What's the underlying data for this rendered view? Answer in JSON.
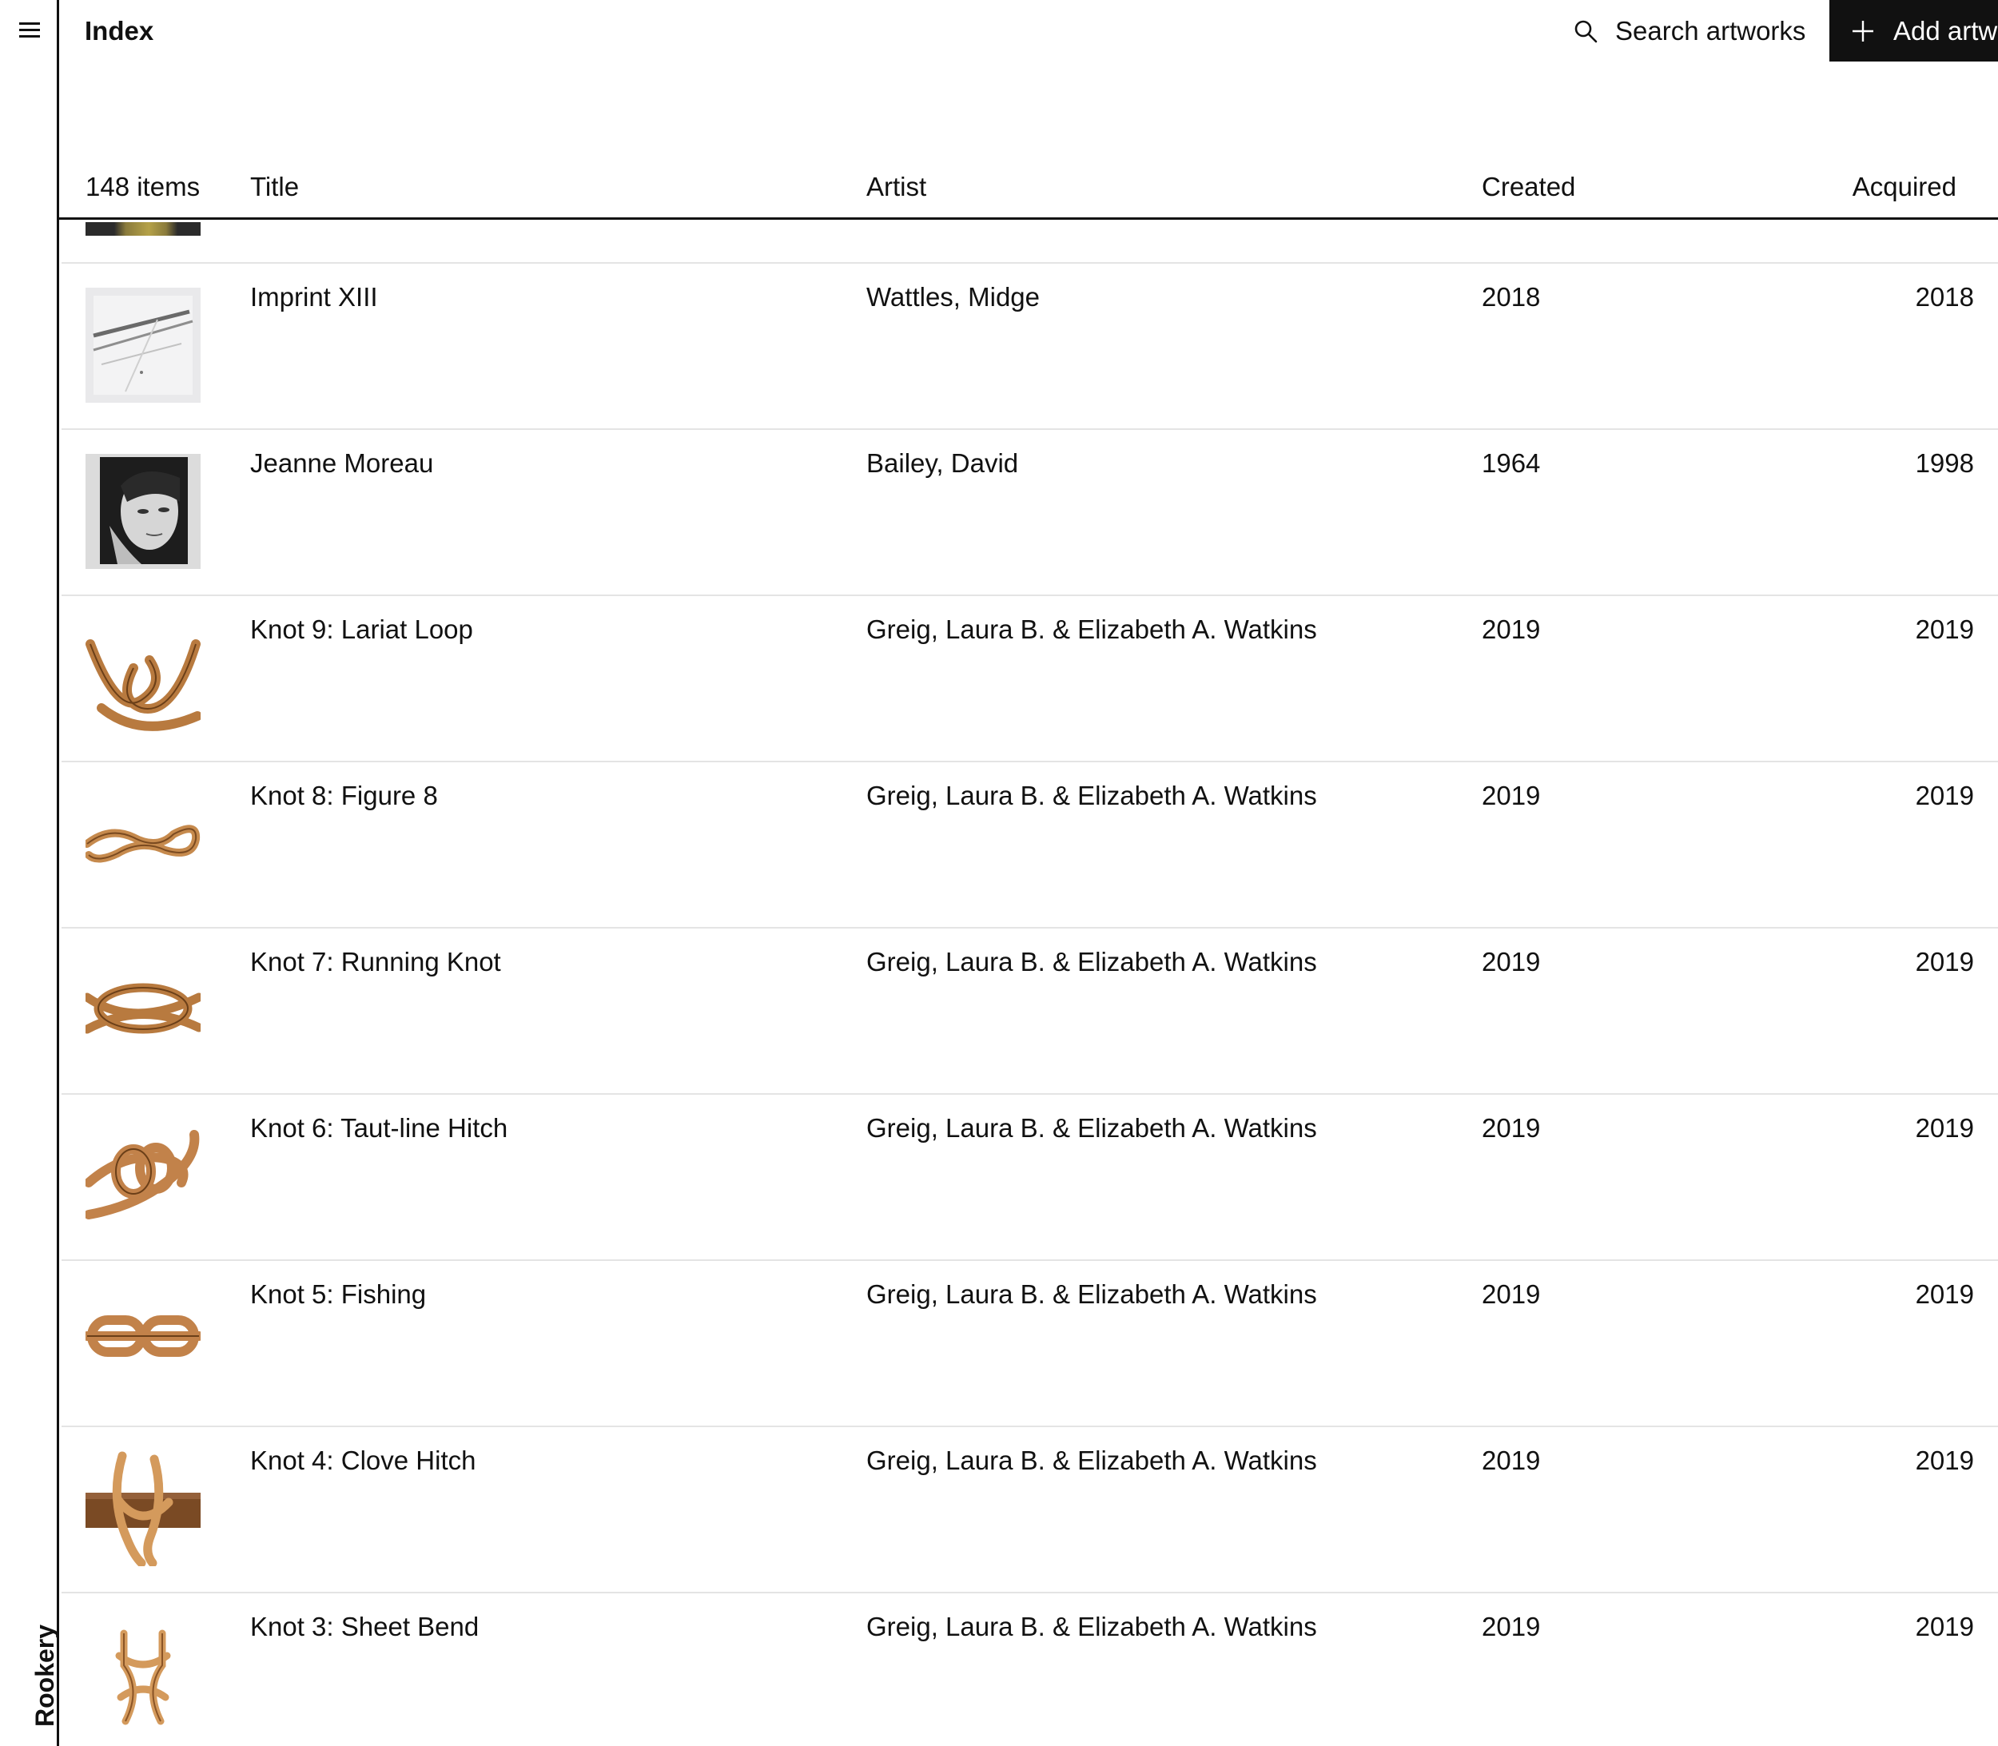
{
  "app": {
    "name": "Rookery"
  },
  "header": {
    "title": "Index",
    "search_label": "Search artworks",
    "add_label": "Add artwork"
  },
  "table": {
    "count": "148 items",
    "columns": {
      "title": "Title",
      "artist": "Artist",
      "created": "Created",
      "acquired": "Acquired"
    },
    "rows": [
      {
        "title": "Imprint XIII",
        "artist": "Wattles, Midge",
        "created": "2018",
        "acquired": "2018",
        "thumb": "abstract-print"
      },
      {
        "title": "Jeanne Moreau",
        "artist": "Bailey, David",
        "created": "1964",
        "acquired": "1998",
        "thumb": "portrait-photo"
      },
      {
        "title": "Knot 9: Lariat Loop",
        "artist": "Greig, Laura B. & Elizabeth A. Watkins",
        "created": "2019",
        "acquired": "2019",
        "thumb": "knot"
      },
      {
        "title": "Knot 8: Figure 8",
        "artist": "Greig, Laura B. & Elizabeth A. Watkins",
        "created": "2019",
        "acquired": "2019",
        "thumb": "knot"
      },
      {
        "title": "Knot 7: Running Knot",
        "artist": "Greig, Laura B. & Elizabeth A. Watkins",
        "created": "2019",
        "acquired": "2019",
        "thumb": "knot"
      },
      {
        "title": "Knot 6: Taut-line Hitch",
        "artist": "Greig, Laura B. & Elizabeth A. Watkins",
        "created": "2019",
        "acquired": "2019",
        "thumb": "knot"
      },
      {
        "title": "Knot 5: Fishing",
        "artist": "Greig, Laura B. & Elizabeth A. Watkins",
        "created": "2019",
        "acquired": "2019",
        "thumb": "knot"
      },
      {
        "title": "Knot 4: Clove Hitch",
        "artist": "Greig, Laura B. & Elizabeth A. Watkins",
        "created": "2019",
        "acquired": "2019",
        "thumb": "knot"
      },
      {
        "title": "Knot 3: Sheet Bend",
        "artist": "Greig, Laura B. & Elizabeth A. Watkins",
        "created": "2019",
        "acquired": "2019",
        "thumb": "knot"
      }
    ]
  },
  "colors": {
    "text": "#111111",
    "divider": "#e4e4e4",
    "button_bg": "#111111",
    "knot_rope": "#b87a3f"
  },
  "icons": {
    "menu": "hamburger-icon",
    "search": "search-icon",
    "add": "plus-icon"
  }
}
